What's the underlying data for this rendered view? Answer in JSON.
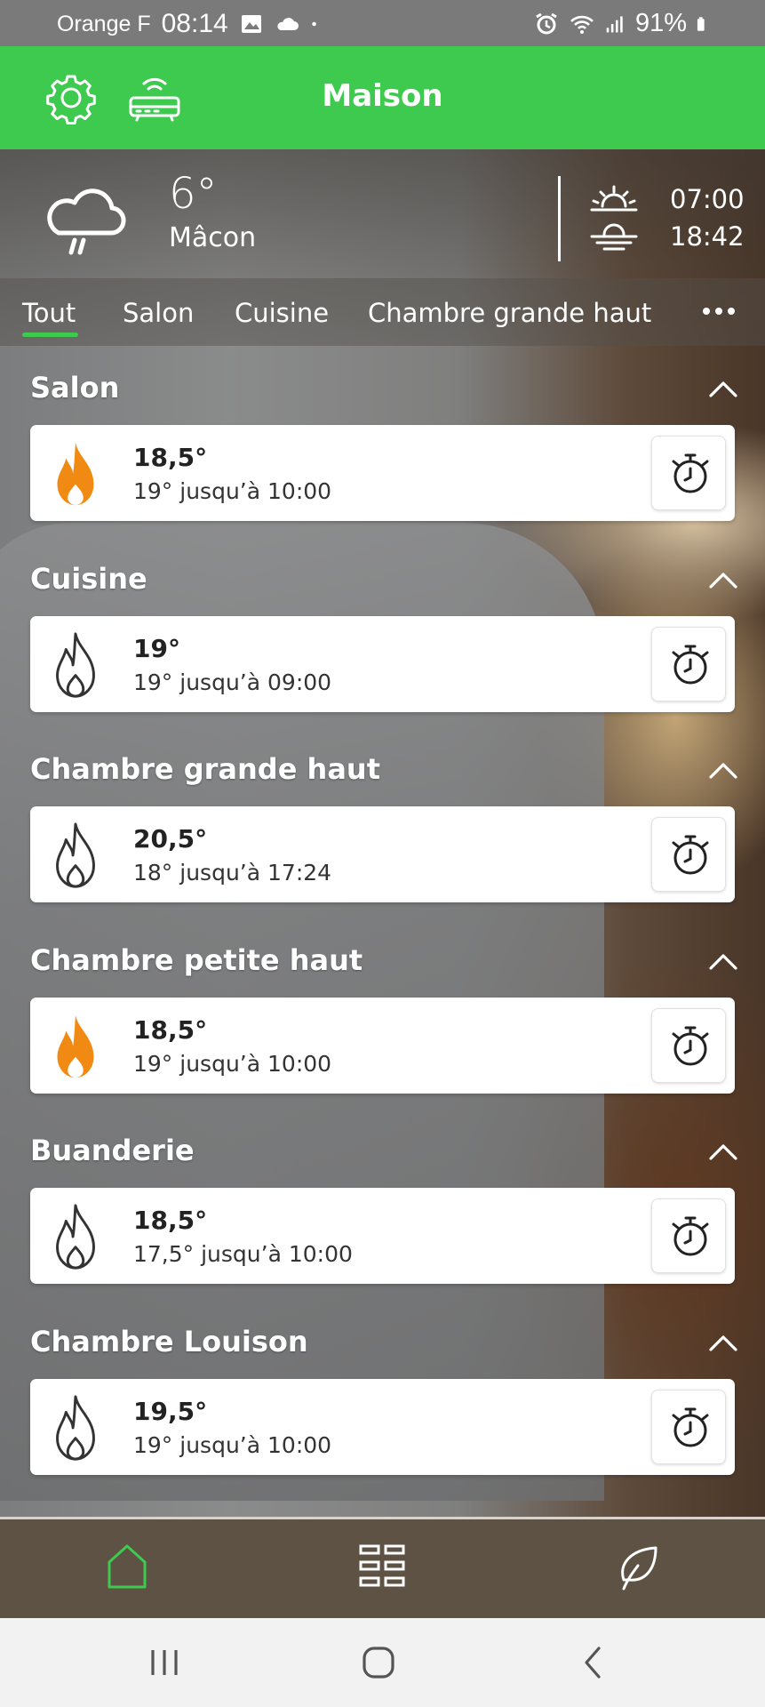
{
  "status_bar": {
    "carrier": "Orange F",
    "time": "08:14",
    "battery": "91%"
  },
  "header": {
    "title": "Maison"
  },
  "weather": {
    "temperature": "6°",
    "city": "Mâcon",
    "sunrise": "07:00",
    "sunset": "18:42"
  },
  "tabs": [
    {
      "label": "Tout",
      "active": true
    },
    {
      "label": "Salon"
    },
    {
      "label": "Cuisine"
    },
    {
      "label": "Chambre grande haut"
    }
  ],
  "colors": {
    "accent": "#3ec94f",
    "flame_active": "#f08a12",
    "nav_background": "#5e5245"
  },
  "rooms": [
    {
      "name": "Salon",
      "temperature": "18,5°",
      "setpoint": "19° jusqu’à 10:00",
      "heating": true
    },
    {
      "name": "Cuisine",
      "temperature": "19°",
      "setpoint": "19° jusqu’à 09:00",
      "heating": false
    },
    {
      "name": "Chambre grande haut",
      "temperature": "20,5°",
      "setpoint": "18° jusqu’à 17:24",
      "heating": false
    },
    {
      "name": "Chambre petite haut",
      "temperature": "18,5°",
      "setpoint": "19° jusqu’à 10:00",
      "heating": true
    },
    {
      "name": "Buanderie",
      "temperature": "18,5°",
      "setpoint": "17,5° jusqu’à 10:00",
      "heating": false
    },
    {
      "name": "Chambre Louison",
      "temperature": "19,5°",
      "setpoint": "19° jusqu’à 10:00",
      "heating": false
    }
  ],
  "icons": {
    "settings": "gear-icon",
    "gateway": "router-icon",
    "weather": "cloud-rain-icon",
    "timer": "stopwatch-icon",
    "nav_home": "home-icon",
    "nav_grid": "grid-icon",
    "nav_eco": "leaf-icon"
  }
}
